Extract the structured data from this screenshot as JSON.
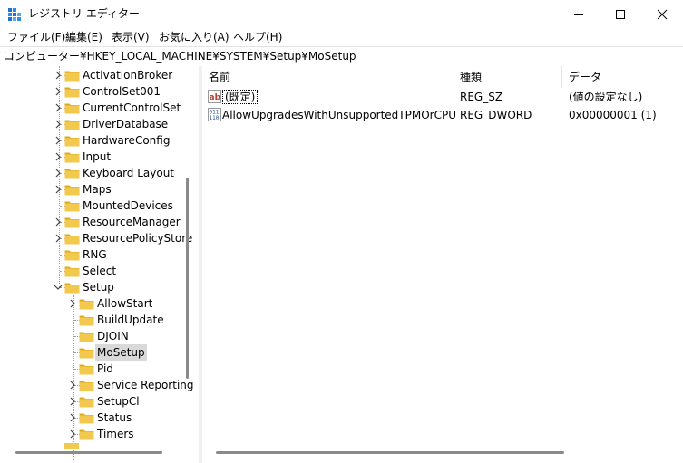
{
  "window": {
    "title": "レジストリ エディター",
    "icon": "registry-editor-icon",
    "controls": [
      "minimize-icon",
      "maximize-icon",
      "close-icon"
    ]
  },
  "menu": [
    "ファイル(F)",
    "編集(E)",
    "表示(V)",
    "お気に入り(A)",
    "ヘルプ(H)"
  ],
  "address": "コンピューター¥HKEY_LOCAL_MACHINE¥SYSTEM¥Setup¥MoSetup",
  "tree": {
    "items": [
      {
        "label": "ActivationBroker",
        "expandable": true
      },
      {
        "label": "ControlSet001",
        "expandable": true
      },
      {
        "label": "CurrentControlSet",
        "expandable": true
      },
      {
        "label": "DriverDatabase",
        "expandable": true
      },
      {
        "label": "HardwareConfig",
        "expandable": true
      },
      {
        "label": "Input",
        "expandable": true
      },
      {
        "label": "Keyboard Layout",
        "expandable": true
      },
      {
        "label": "Maps",
        "expandable": true
      },
      {
        "label": "MountedDevices",
        "expandable": false
      },
      {
        "label": "ResourceManager",
        "expandable": true
      },
      {
        "label": "ResourcePolicyStore",
        "expandable": true
      },
      {
        "label": "RNG",
        "expandable": false
      },
      {
        "label": "Select",
        "expandable": false
      },
      {
        "label": "Setup",
        "expandable": true,
        "expanded": true
      },
      {
        "label": "AllowStart",
        "expandable": true,
        "child": true
      },
      {
        "label": "BuildUpdate",
        "expandable": false,
        "child": true
      },
      {
        "label": "DJOIN",
        "expandable": false,
        "child": true
      },
      {
        "label": "MoSetup",
        "expandable": false,
        "child": true,
        "selected": true
      },
      {
        "label": "Pid",
        "expandable": false,
        "child": true
      },
      {
        "label": "Service Reporting",
        "expandable": true,
        "child": true
      },
      {
        "label": "SetupCl",
        "expandable": true,
        "child": true
      },
      {
        "label": "Status",
        "expandable": true,
        "child": true
      },
      {
        "label": "Timers",
        "expandable": true,
        "child": true
      }
    ]
  },
  "list": {
    "columns": [
      "名前",
      "種類",
      "データ"
    ],
    "rows": [
      {
        "icon": "string-value-icon",
        "name": "(既定)",
        "type": "REG_SZ",
        "data": "(値の設定なし)"
      },
      {
        "icon": "binary-value-icon",
        "name": "AllowUpgradesWithUnsupportedTPMOrCPU",
        "type": "REG_DWORD",
        "data": "0x00000001 (1)"
      }
    ]
  },
  "colors": {
    "folder": "#f2c94c",
    "folder_dark": "#e0a91a",
    "selected": "#d9d9d9",
    "string_icon": "#c0392b",
    "binary_icon": "#1f4e9a"
  }
}
